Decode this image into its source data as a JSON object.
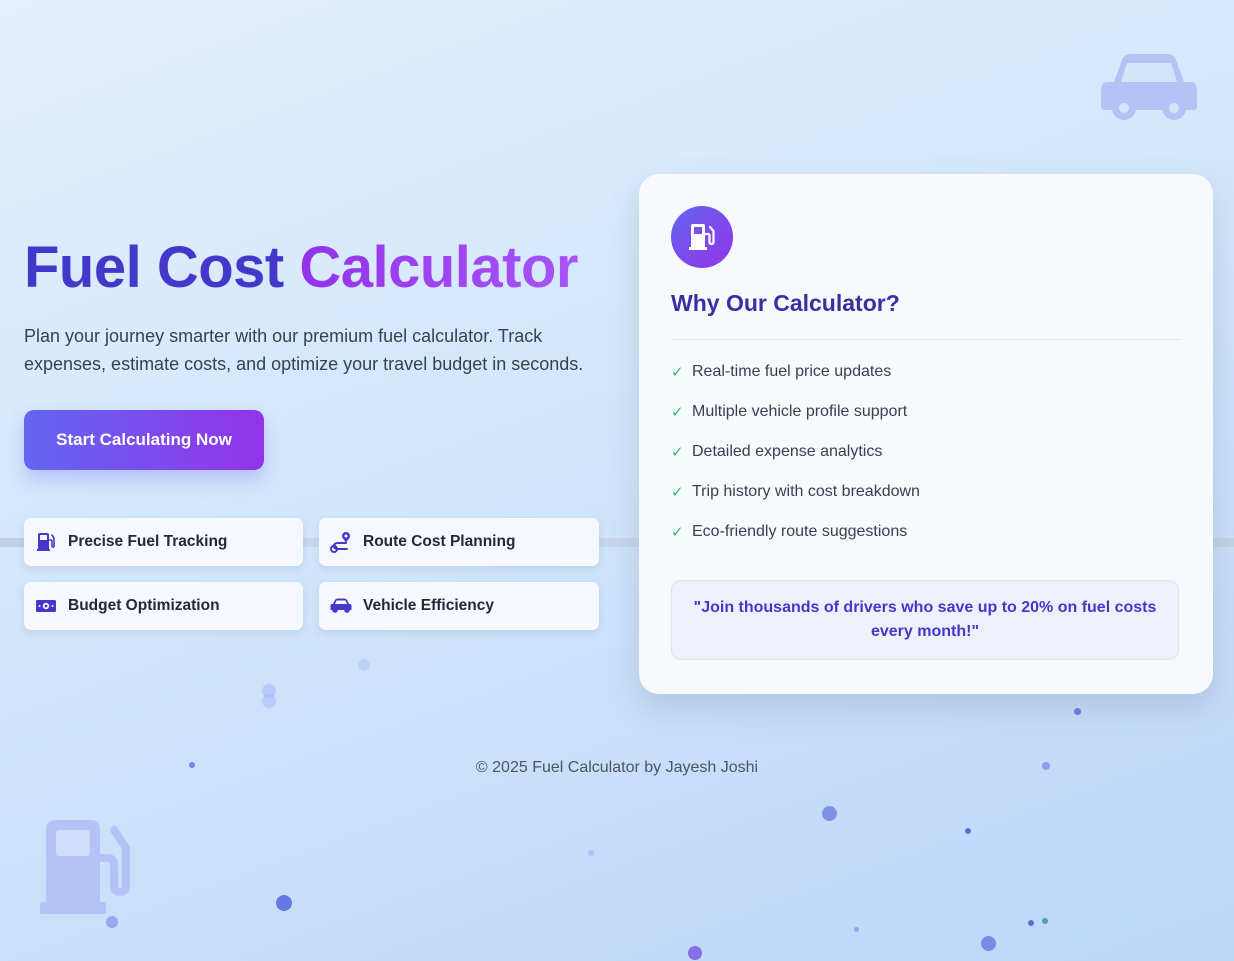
{
  "hero": {
    "title_part1": "Fuel Cost",
    "title_part2": "Calculator",
    "subtitle": "Plan your journey smarter with our premium fuel calculator. Track expenses, estimate costs, and optimize your travel budget in seconds.",
    "cta_label": "Start Calculating Now"
  },
  "features": [
    {
      "label": "Precise Fuel Tracking",
      "icon": "gas-pump-icon"
    },
    {
      "label": "Route Cost Planning",
      "icon": "route-icon"
    },
    {
      "label": "Budget Optimization",
      "icon": "money-bill-icon"
    },
    {
      "label": "Vehicle Efficiency",
      "icon": "car-icon"
    }
  ],
  "card": {
    "badge_icon": "gas-pump-icon",
    "title": "Why Our Calculator?",
    "check_symbol": "✓",
    "items": [
      "Real-time fuel price updates",
      "Multiple vehicle profile support",
      "Detailed expense analytics",
      "Trip history with cost breakdown",
      "Eco-friendly route suggestions"
    ],
    "quote": "\"Join thousands of drivers who save up to 20% on fuel costs every month!\""
  },
  "footer": {
    "text": "© 2025 Fuel Calculator by Jayesh Joshi"
  },
  "colors": {
    "primary": "#4338ca",
    "accent": "#9333ea",
    "check": "#22c55e",
    "background": "#d2e6fb"
  }
}
